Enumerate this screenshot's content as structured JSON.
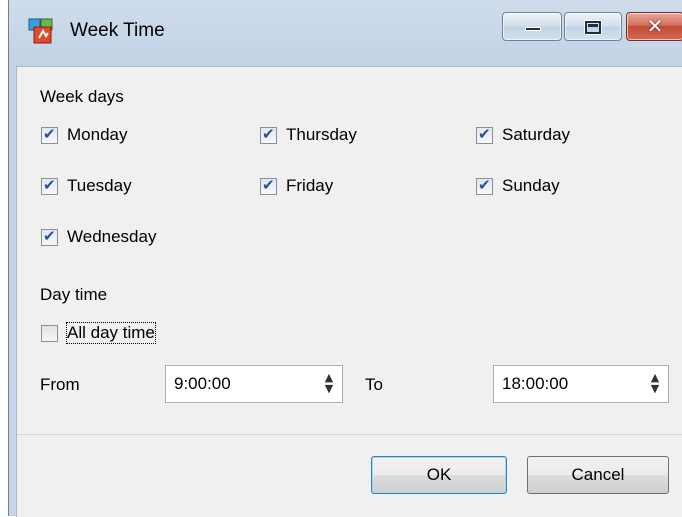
{
  "window": {
    "title": "Week Time",
    "controls": {
      "minimize": "minimize-icon",
      "maximize": "maximize-icon",
      "close": "close-icon",
      "close_glyph": "✕"
    }
  },
  "week_days": {
    "label": "Week days",
    "days": [
      {
        "label": "Monday",
        "checked": true
      },
      {
        "label": "Thursday",
        "checked": true
      },
      {
        "label": "Saturday",
        "checked": true
      },
      {
        "label": "Tuesday",
        "checked": true
      },
      {
        "label": "Friday",
        "checked": true
      },
      {
        "label": "Sunday",
        "checked": true
      },
      {
        "label": "Wednesday",
        "checked": true
      }
    ]
  },
  "day_time": {
    "label": "Day time",
    "all_day": {
      "label": "All day time",
      "checked": false
    },
    "from": {
      "label": "From",
      "value": "9:00:00"
    },
    "to": {
      "label": "To",
      "value": "18:00:00"
    }
  },
  "buttons": {
    "ok": "OK",
    "cancel": "Cancel"
  }
}
